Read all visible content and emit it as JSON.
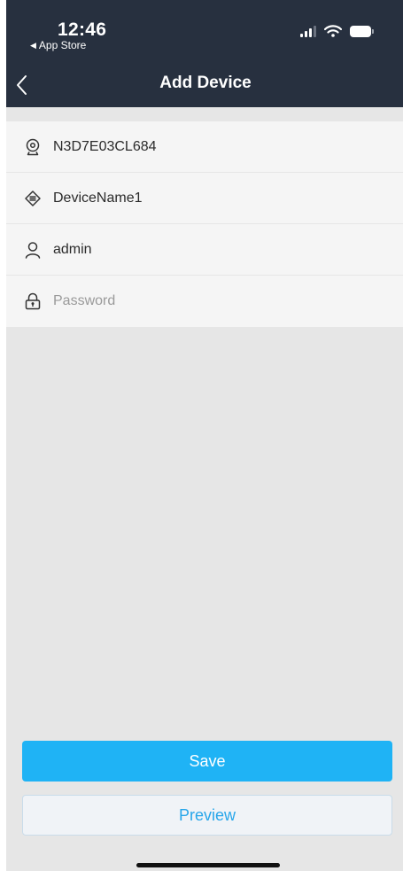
{
  "status_bar": {
    "time": "12:46",
    "back_app": "App Store"
  },
  "nav": {
    "title": "Add Device"
  },
  "form": {
    "fields": [
      {
        "icon": "camera-icon",
        "value": "N3D7E03CL684",
        "placeholder": ""
      },
      {
        "icon": "device-icon",
        "value": "DeviceName1",
        "placeholder": ""
      },
      {
        "icon": "user-icon",
        "value": "admin",
        "placeholder": ""
      },
      {
        "icon": "lock-icon",
        "value": "",
        "placeholder": "Password"
      }
    ]
  },
  "buttons": {
    "save_label": "Save",
    "preview_label": "Preview"
  },
  "colors": {
    "header": "#27303f",
    "primary": "#1fb3f5",
    "background": "#e6e6e6",
    "field_background": "#f5f5f5"
  }
}
